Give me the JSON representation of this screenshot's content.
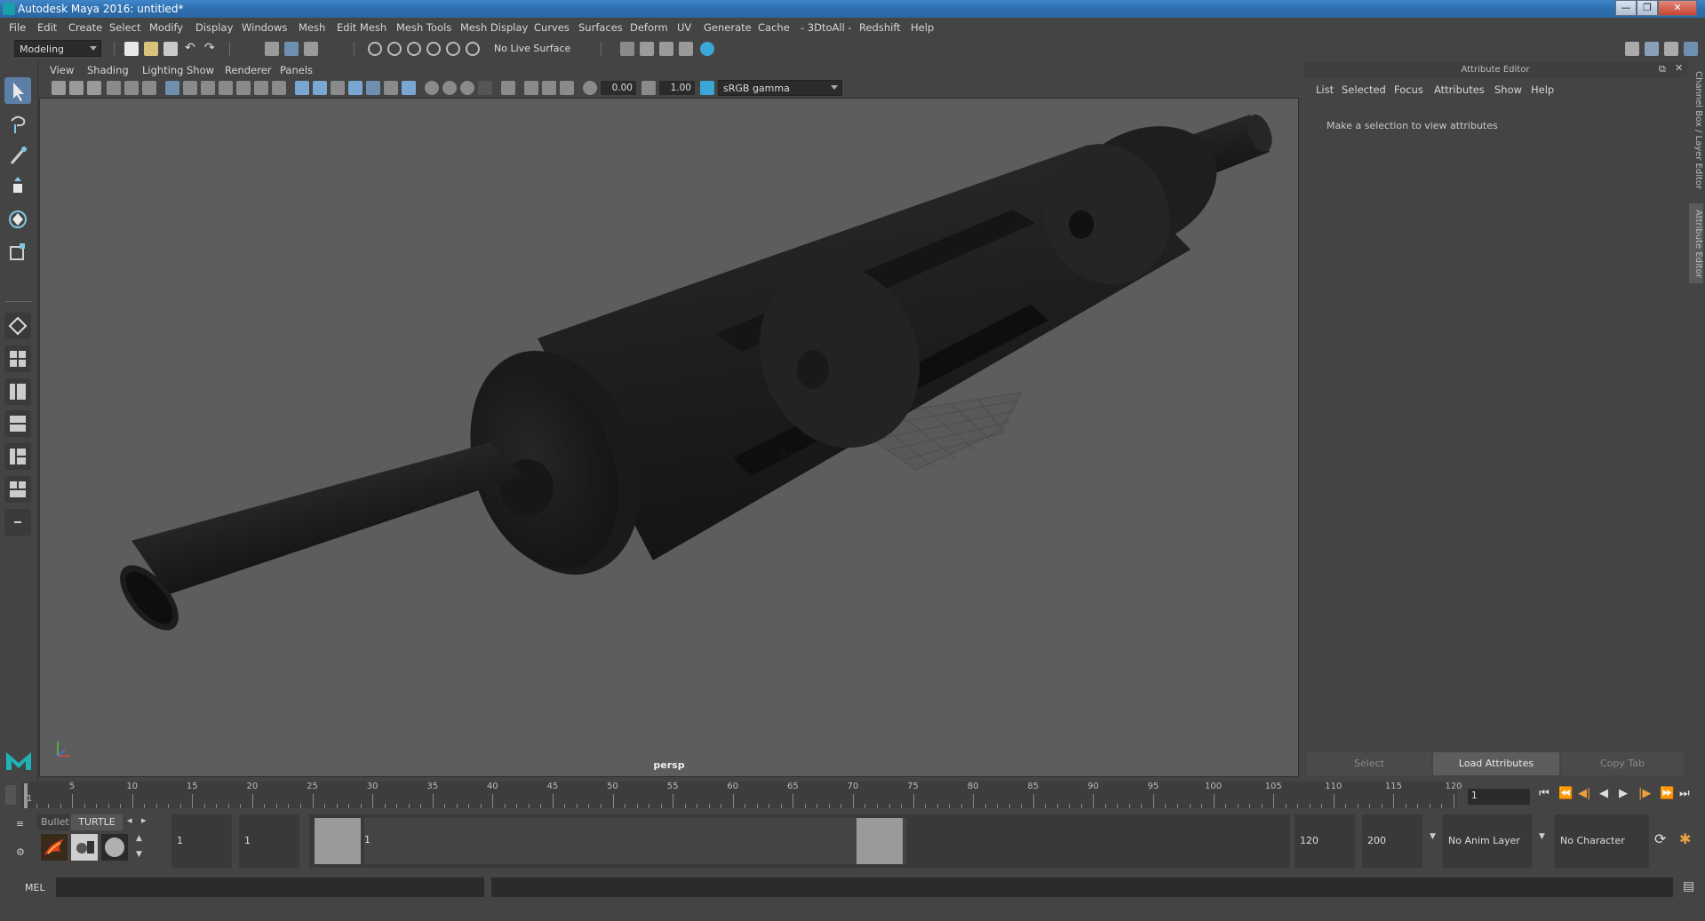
{
  "window": {
    "title": "Autodesk Maya 2016: untitled*"
  },
  "menubar": [
    "File",
    "Edit",
    "Create",
    "Select",
    "Modify",
    "Display",
    "Windows",
    "Mesh",
    "Edit Mesh",
    "Mesh Tools",
    "Mesh Display",
    "Curves",
    "Surfaces",
    "Deform",
    "UV",
    "Generate",
    "Cache",
    "- 3DtoAll -",
    "Redshift",
    "Help"
  ],
  "statusline": {
    "mode": "Modeling",
    "live_surface": "No Live Surface"
  },
  "panel": {
    "menus": [
      "View",
      "Shading",
      "Lighting",
      "Show",
      "Renderer",
      "Panels"
    ],
    "exposure": "0.00",
    "gamma": "1.00",
    "color_space": "sRGB gamma",
    "camera": "persp"
  },
  "attribute_editor": {
    "title": "Attribute Editor",
    "menus": [
      "List",
      "Selected",
      "Focus",
      "Attributes",
      "Show",
      "Help"
    ],
    "message": "Make a selection to view attributes",
    "buttons": {
      "select": "Select",
      "load": "Load Attributes",
      "copy": "Copy Tab"
    }
  },
  "side_tabs": {
    "channel_box": "Channel Box / Layer Editor",
    "attribute_editor": "Attribute Editor"
  },
  "timeline": {
    "ticks": [
      "1",
      "5",
      "10",
      "15",
      "20",
      "25",
      "30",
      "35",
      "40",
      "45",
      "50",
      "55",
      "60",
      "65",
      "70",
      "75",
      "80",
      "85",
      "90",
      "95",
      "100",
      "105",
      "110",
      "115",
      "120"
    ],
    "current_frame": "1"
  },
  "shelf": {
    "tabs": [
      "Bullet",
      "TURTLE"
    ]
  },
  "range": {
    "start": "1",
    "playback_start": "1",
    "slider_min": "1",
    "slider_max": "120",
    "playback_end": "120",
    "end": "200",
    "anim_layer": "No Anim Layer",
    "character_set": "No Character Set"
  },
  "command_line": {
    "language": "MEL"
  }
}
